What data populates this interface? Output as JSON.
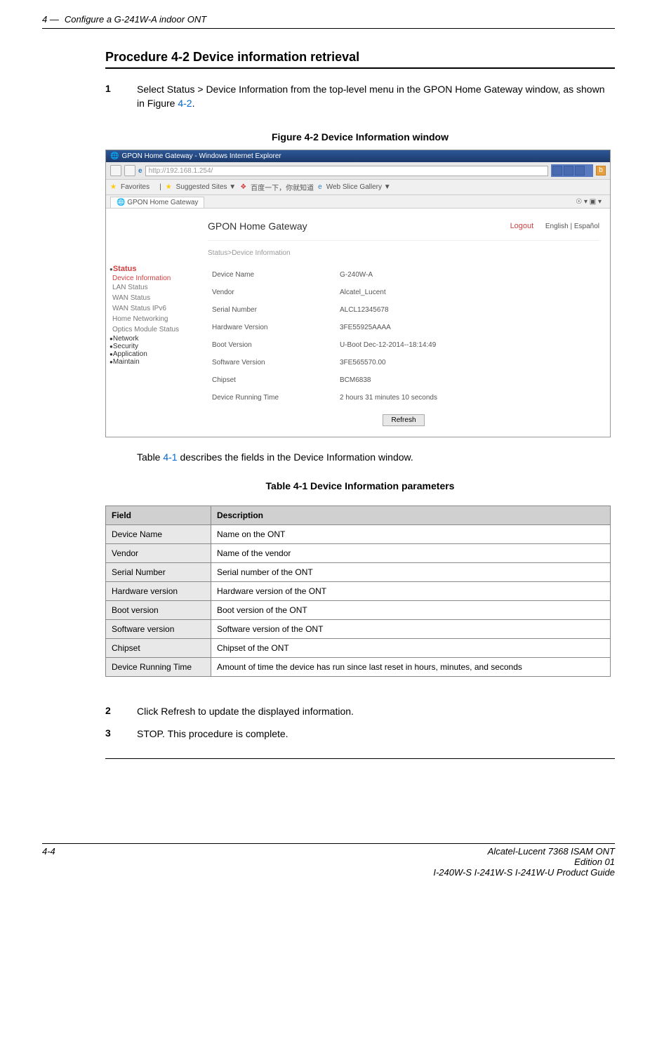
{
  "header": {
    "section_num": "4 —",
    "section_title": "Configure a G-241W-A indoor ONT"
  },
  "procedure": {
    "title": "Procedure 4-2  Device information retrieval"
  },
  "steps": {
    "s1_num": "1",
    "s1_text_a": "Select Status > Device Information from the top-level menu in the GPON Home Gateway window, as shown in Figure ",
    "s1_link": "4-2",
    "s1_text_b": ".",
    "s2_num": "2",
    "s2_text": "Click Refresh to update the displayed information.",
    "s3_num": "3",
    "s3_text": "STOP. This procedure is complete."
  },
  "figure": {
    "title": "Figure 4-2  Device Information window"
  },
  "browser": {
    "title": "GPON Home Gateway - Windows Internet Explorer",
    "url_icon": "e",
    "url": "http://192.168.1.254/",
    "favorites": "Favorites",
    "suggested": "Suggested Sites ▼",
    "baidu": "百度一下，你就知道",
    "webslice": "Web Slice Gallery ▼",
    "tab": "GPON Home Gateway",
    "search_icon": "b",
    "tools": "☉ ▾ ▣ ▾"
  },
  "gpon": {
    "title": "GPON Home Gateway",
    "logout": "Logout",
    "lang_en": "English |",
    "lang_es": "Español",
    "breadcrumb": "Status>Device Information",
    "refresh": "Refresh"
  },
  "sidebar": {
    "status": "Status",
    "device_info": "Device Information",
    "lan_status": "LAN Status",
    "wan_status": "WAN Status",
    "wan_ipv6": "WAN Status IPv6",
    "home_net": "Home Networking",
    "optics": "Optics Module Status",
    "network": "Network",
    "security": "Security",
    "application": "Application",
    "maintain": "Maintain"
  },
  "device_info": {
    "device_name_label": "Device Name",
    "device_name_value": "G-240W-A",
    "vendor_label": "Vendor",
    "vendor_value": "Alcatel_Lucent",
    "serial_label": "Serial Number",
    "serial_value": "ALCL12345678",
    "hw_label": "Hardware Version",
    "hw_value": "3FE55925AAAA",
    "boot_label": "Boot Version",
    "boot_value": "U-Boot Dec-12-2014--18:14:49",
    "sw_label": "Software Version",
    "sw_value": "3FE565570.00",
    "chipset_label": "Chipset",
    "chipset_value": "BCM6838",
    "runtime_label": "Device Running Time",
    "runtime_value": "2 hours 31 minutes 10 seconds"
  },
  "describe": {
    "text_a": "Table ",
    "link": "4-1",
    "text_b": " describes the fields in the Device Information window."
  },
  "table": {
    "title": "Table 4-1 Device Information parameters",
    "header_field": "Field",
    "header_desc": "Description",
    "rows": {
      "r0_field": "Device Name",
      "r0_desc": "Name on the ONT",
      "r1_field": "Vendor",
      "r1_desc": "Name of the vendor",
      "r2_field": "Serial Number",
      "r2_desc": "Serial number of the ONT",
      "r3_field": "Hardware version",
      "r3_desc": "Hardware version of the ONT",
      "r4_field": "Boot version",
      "r4_desc": "Boot version of the ONT",
      "r5_field": "Software version",
      "r5_desc": "Software version of the ONT",
      "r6_field": "Chipset",
      "r6_desc": "Chipset of the ONT",
      "r7_field": "Device Running Time",
      "r7_desc": "Amount of time the device has run since last reset in hours, minutes, and seconds"
    }
  },
  "footer": {
    "page": "4-4",
    "line1": "Alcatel-Lucent 7368 ISAM ONT",
    "line2": "Edition 01",
    "line3": "I-240W-S I-241W-S I-241W-U Product Guide"
  }
}
